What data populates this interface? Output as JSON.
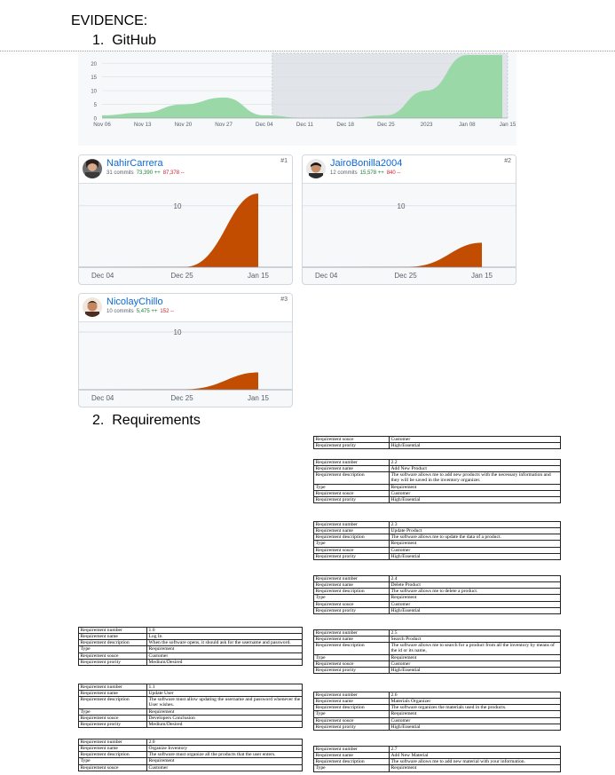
{
  "doc": {
    "heading": "EVIDENCE:",
    "section1": {
      "number": "1.",
      "title": "GitHub"
    },
    "section2": {
      "number": "2.",
      "title": "Requirements"
    }
  },
  "colors": {
    "summary_fill": "#9ad8a8",
    "contributor_fill": "#c24c00",
    "link": "#0969da",
    "additions": "#1a7f37",
    "deletions": "#cf222e"
  },
  "chart_data": [
    {
      "type": "area",
      "title": "",
      "x": [
        "Nov 06",
        "Nov 13",
        "Nov 20",
        "Nov 27",
        "Dec 04",
        "Dec 11",
        "Dec 18",
        "Dec 25",
        "2023",
        "Jan 08",
        "Jan 15"
      ],
      "y": [
        1,
        2,
        5,
        7.5,
        1,
        0,
        0,
        1,
        10,
        23,
        23
      ],
      "yticks": [
        "0",
        "5",
        "10",
        "15",
        "20"
      ],
      "ylim": [
        0,
        23
      ],
      "selection_range": [
        "Dec 04",
        "Jan 15"
      ]
    },
    {
      "type": "area",
      "contributor": "NahirCarrera",
      "commits": "31 commits",
      "additions": "73,390 ++",
      "deletions": "87,378 --",
      "rank": "#1",
      "x": [
        "Dec 04",
        "Dec 25",
        "Jan 15"
      ],
      "y": [
        0,
        3,
        12
      ],
      "ylabel_tick": "10",
      "ylim": [
        0,
        12
      ]
    },
    {
      "type": "area",
      "contributor": "JairoBonilla2004",
      "commits": "12 commits",
      "additions": "15,578 ++",
      "deletions": "840 --",
      "rank": "#2",
      "x": [
        "Dec 04",
        "Dec 25",
        "Jan 15"
      ],
      "y": [
        0,
        0.5,
        4
      ],
      "ylabel_tick": "10",
      "ylim": [
        0,
        12
      ]
    },
    {
      "type": "area",
      "contributor": "NicolayChillo",
      "commits": "10 commits",
      "additions": "5,475 ++",
      "deletions": "152 --",
      "rank": "#3",
      "x": [
        "Dec 04",
        "Dec 25",
        "Jan 15"
      ],
      "y": [
        0,
        1,
        3
      ],
      "ylabel_tick": "10",
      "ylim": [
        0,
        10
      ]
    }
  ],
  "right_top_rows": [
    [
      "Requirement souce",
      "Customer"
    ],
    [
      "Requirement prority",
      "High/Essential"
    ]
  ],
  "right_tables": [
    [
      [
        "Requirement number",
        "2.2"
      ],
      [
        "Requirement name",
        "Add New Product"
      ],
      [
        "Requirement description",
        "The software allows me to add new products with the necessary information and they will be saved in the inventory organizer."
      ],
      [
        "Type",
        "Requirement"
      ],
      [
        "Requirement souce",
        "Customer"
      ],
      [
        "Requirement prority",
        "High/Essential"
      ]
    ],
    [
      [
        "Requirement number",
        "2.3"
      ],
      [
        "Requirement name",
        "Update Product"
      ],
      [
        "Requirement description",
        "The software allows me to update the data of a product."
      ],
      [
        "Type",
        "Requirement"
      ],
      [
        "Requirement souce",
        "Customer"
      ],
      [
        "Requirement prority",
        "High/Essential"
      ]
    ],
    [
      [
        "Requirement number",
        "2.4"
      ],
      [
        "Requirement name",
        "Delete Product"
      ],
      [
        "Requirement description",
        "The software allows me to delete a product."
      ],
      [
        "Type",
        "Requirement"
      ],
      [
        "Requirement souce",
        "Customer"
      ],
      [
        "Requirement prority",
        "High/Essential"
      ]
    ],
    [
      [
        "Requirement number",
        "2.5"
      ],
      [
        "Requirement name",
        "Search Product"
      ],
      [
        "Requirement description",
        "The software allows me to search for a product from all the inventory by means of the id or its name,"
      ],
      [
        "Type",
        "Requirement"
      ],
      [
        "Requirement souce",
        "Customer"
      ],
      [
        "Requirement prority",
        "High/Essential"
      ]
    ],
    [
      [
        "Requirement number",
        "2.6"
      ],
      [
        "Requirement name",
        "Materials Organizer"
      ],
      [
        "Requirement description",
        "The software organizes the materials used in the products."
      ],
      [
        "Type",
        "Requirement"
      ],
      [
        "Requirement souce",
        "Customer"
      ],
      [
        "Requirement prority",
        "High/Essential"
      ]
    ],
    [
      [
        "Requirement number",
        "2.7"
      ],
      [
        "Requirement name",
        "Add  New Material"
      ],
      [
        "Requirement description",
        "The software allows me to add new material with your information."
      ],
      [
        "Type",
        "Requirement"
      ]
    ]
  ],
  "left_tables": [
    [
      [
        "Requirement number",
        "1.0"
      ],
      [
        "Requirement name",
        "Log In"
      ],
      [
        "Requirement description",
        "When the software opens, it should ask for the username and password."
      ],
      [
        "Type",
        "Requirement"
      ],
      [
        "Requirement souce",
        "Customer"
      ],
      [
        "Requirement prority",
        "Medium/Desired"
      ]
    ],
    [
      [
        "Requirement number",
        "1.1"
      ],
      [
        "Requirement name",
        "Update User"
      ],
      [
        "Requirement description",
        "The software must allow updating the username and password whenever the User wishes."
      ],
      [
        "Type",
        "Requirement"
      ],
      [
        "Requirement souce",
        "Developers Conclusion"
      ],
      [
        "Requirement prority",
        "Medium/Desired"
      ]
    ],
    [
      [
        "Requirement number",
        "2.0"
      ],
      [
        "Requirement name",
        "Organize Inventory"
      ],
      [
        "Requirement description",
        "The software must organize all the products that the user enters."
      ],
      [
        "Type",
        "Requirement"
      ],
      [
        "Requirement souce",
        "Customer"
      ]
    ]
  ]
}
